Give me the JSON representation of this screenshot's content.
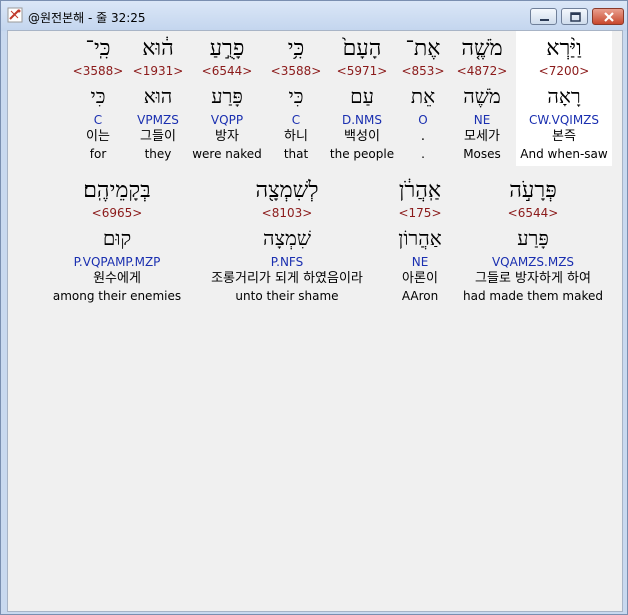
{
  "window": {
    "title": "@원전본해 - 줄 32:25",
    "colors": {
      "strong": "#8b1a1a",
      "morph": "#1a2fb0",
      "highlight": "#ffffff"
    }
  },
  "rows": [
    {
      "words": [
        {
          "hebrew": "כִּֽי־",
          "strong": "<3588>",
          "lemma": "כִּי",
          "morph": "C",
          "korean": "이는",
          "english": "for",
          "highlight": false
        },
        {
          "hebrew": "ה֔וּא",
          "strong": "<1931>",
          "lemma": "הוּא",
          "morph": "VPMZS",
          "korean": "그들이",
          "english": "they",
          "highlight": false
        },
        {
          "hebrew": "פָרֻ֣עַ",
          "strong": "<6544>",
          "lemma": "פָּרַע",
          "morph": "VQPP",
          "korean": "방자",
          "english": "were naked",
          "highlight": false
        },
        {
          "hebrew": "כִּ֥י",
          "strong": "<3588>",
          "lemma": "כִּי",
          "morph": "C",
          "korean": "하니",
          "english": "that",
          "highlight": false
        },
        {
          "hebrew": "הָעָם֙",
          "strong": "<5971>",
          "lemma": "עַם",
          "morph": "D.NMS",
          "korean": "백성이",
          "english": "the people",
          "highlight": false
        },
        {
          "hebrew": "אֶת־",
          "strong": "<853>",
          "lemma": "אֵת",
          "morph": "O",
          "korean": ".",
          "english": ".",
          "highlight": false
        },
        {
          "hebrew": "מֹשֶׁ֤ה",
          "strong": "<4872>",
          "lemma": "מֹשֶׁה",
          "morph": "NE",
          "korean": "모세가",
          "english": "Moses",
          "highlight": false
        },
        {
          "hebrew": "וַיַּ֨רְא",
          "strong": "<7200>",
          "lemma": "רָאָה",
          "morph": "CW.VQIMZS",
          "korean": "본즉",
          "english": "And when-saw",
          "highlight": true
        }
      ]
    },
    {
      "words": [
        {
          "hebrew": "בְּקָמֵיהֶֽם׃",
          "strong": "<6965>",
          "lemma": "קוּם",
          "morph": "P.VQPAMP.MZP",
          "korean": "원수에게",
          "english": "among their enemies",
          "highlight": false
        },
        {
          "hebrew": "לְשִׁמְצָ֖ה",
          "strong": "<8103>",
          "lemma": "שִׁמְצָה",
          "morph": "P.NFS",
          "korean": "조롱거리가 되게 하였음이라",
          "english": "unto their shame",
          "highlight": false
        },
        {
          "hebrew": "אַֽהֲרֹ֔ן",
          "strong": "<175>",
          "lemma": "אַהֲרוֹן",
          "morph": "NE",
          "korean": "아론이",
          "english": "AAron",
          "highlight": false
        },
        {
          "hebrew": "פְּרָעֹ֣ה",
          "strong": "<6544>",
          "lemma": "פָּרַע",
          "morph": "VQAMZS.MZS",
          "korean": "그들로 방자하게 하여",
          "english": "had made them maked",
          "highlight": false
        }
      ]
    }
  ]
}
